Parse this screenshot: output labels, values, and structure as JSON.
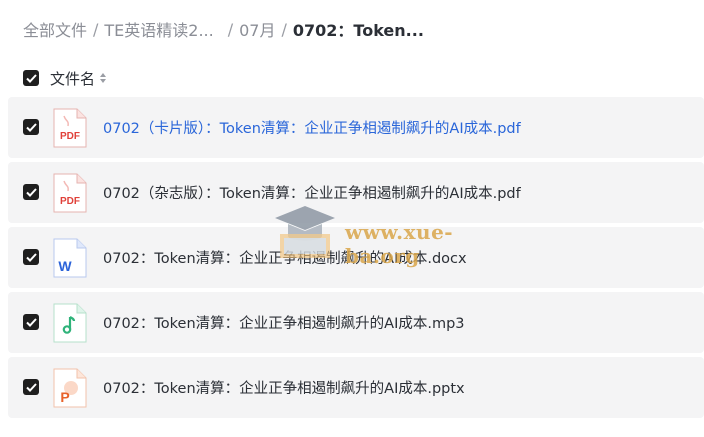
{
  "breadcrumb": {
    "items": [
      "全部文件",
      "TE英语精读2...",
      "07月"
    ],
    "current": "0702：Token..."
  },
  "header": {
    "column_label": "文件名"
  },
  "files": [
    {
      "name": "0702（卡片版）：Token清算：企业正争相遏制飙升的AI成本.pdf",
      "type": "pdf",
      "icon": "pdf-icon",
      "icon_text": "PDF"
    },
    {
      "name": "0702（杂志版）：Token清算：企业正争相遏制飙升的AI成本.pdf",
      "type": "pdf",
      "icon": "pdf-icon",
      "icon_text": "PDF"
    },
    {
      "name": "0702：Token清算：企业正争相遏制飙升的AI成本.docx",
      "type": "docx",
      "icon": "word-icon",
      "icon_text": "W"
    },
    {
      "name": "0702：Token清算：企业正争相遏制飙升的AI成本.mp3",
      "type": "mp3",
      "icon": "audio-icon",
      "icon_text": "♫"
    },
    {
      "name": "0702：Token清算：企业正争相遏制飙升的AI成本.pptx",
      "type": "pptx",
      "icon": "powerpoint-icon",
      "icon_text": "P"
    }
  ],
  "watermark": {
    "text": "www.xue-ba.org"
  },
  "colors": {
    "link": "#2a66d9",
    "pdf": "#e0413a",
    "word": "#2b63d9",
    "audio": "#2fb37a",
    "ppt": "#e8622a"
  }
}
